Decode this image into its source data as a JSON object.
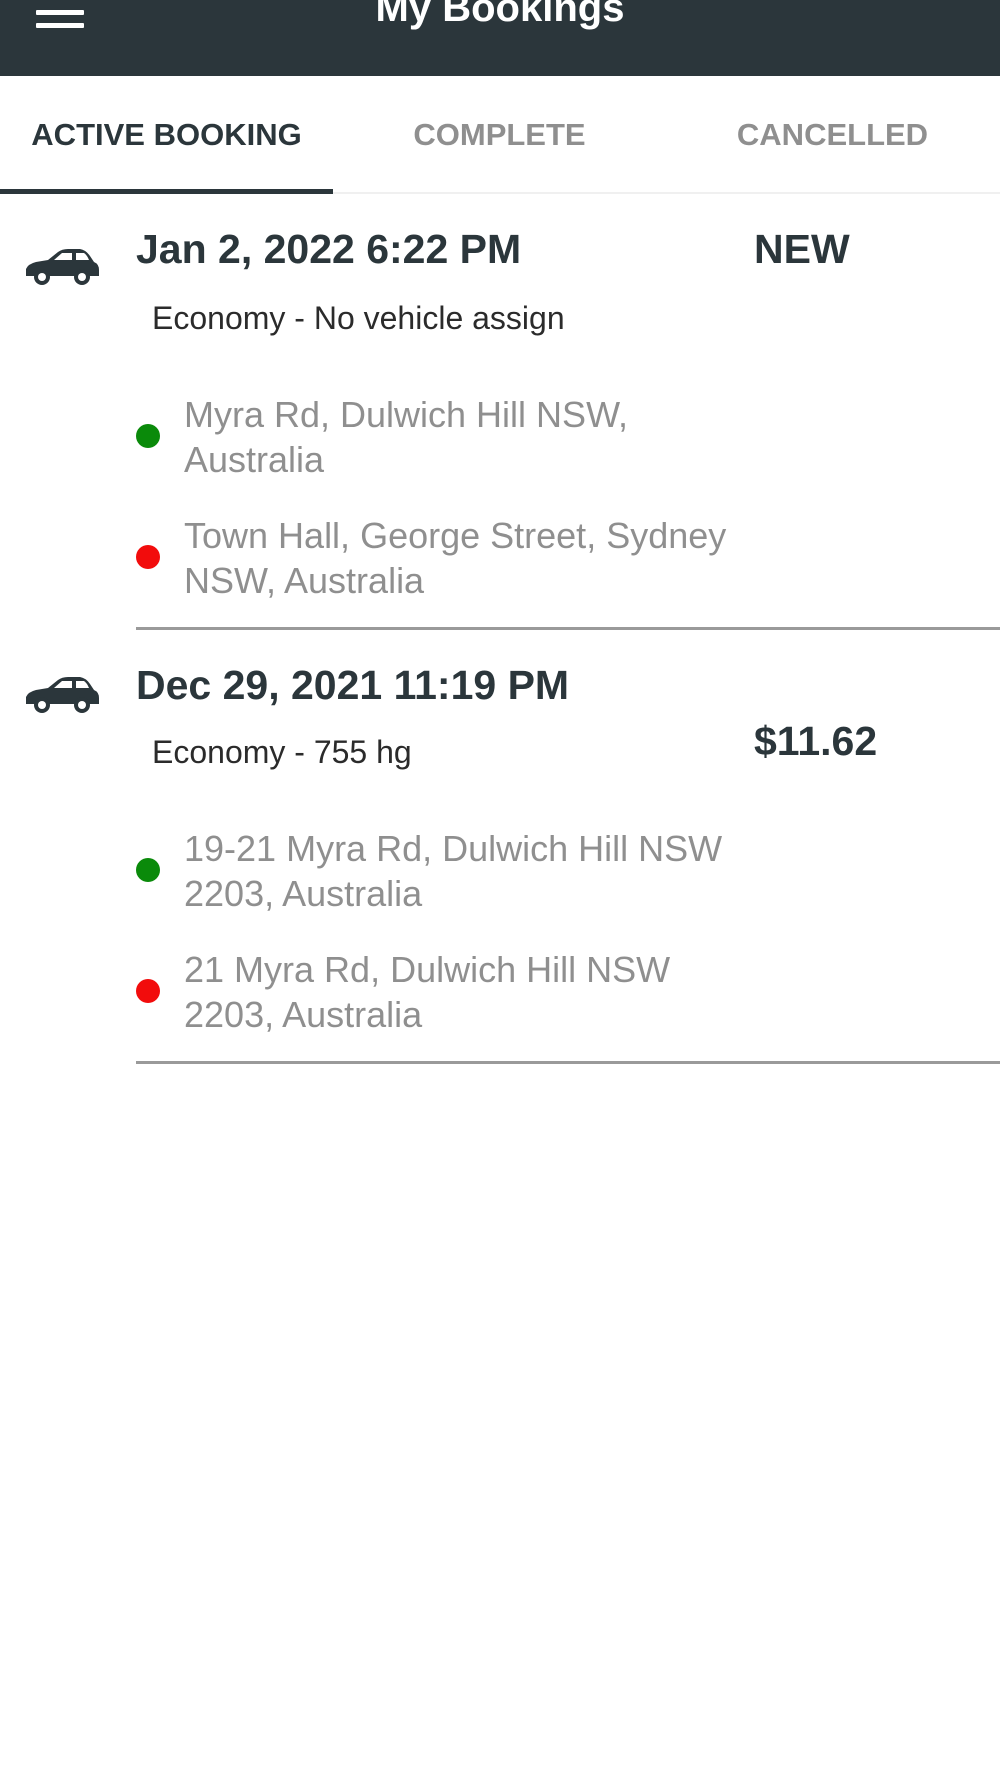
{
  "header": {
    "title": "My Bookings",
    "menu_icon": "hamburger-menu-icon"
  },
  "tabs": [
    {
      "label": "ACTIVE BOOKING",
      "active": true
    },
    {
      "label": "COMPLETE",
      "active": false
    },
    {
      "label": "CANCELLED",
      "active": false
    }
  ],
  "bookings": [
    {
      "icon": "car-icon",
      "datetime": "Jan 2, 2022 6:22 PM",
      "status": "NEW",
      "fare": "",
      "service": "Economy - No vehicle assign",
      "pickup": "Myra Rd, Dulwich Hill NSW, Australia",
      "dropoff": "Town Hall, George Street, Sydney NSW, Australia"
    },
    {
      "icon": "car-icon",
      "datetime": "Dec 29, 2021 11:19 PM",
      "status": "",
      "fare": "$11.62",
      "service": "Economy - 755 hg",
      "pickup": "19-21 Myra Rd, Dulwich Hill NSW 2203, Australia",
      "dropoff": "21 Myra Rd, Dulwich Hill NSW 2203, Australia"
    }
  ],
  "colors": {
    "header_bg": "#2b363b",
    "pickup_dot": "#0a8a0a",
    "dropoff_dot": "#f20c0c",
    "inactive_tab": "#8f8f8f",
    "address_text": "#8f8f8f"
  }
}
